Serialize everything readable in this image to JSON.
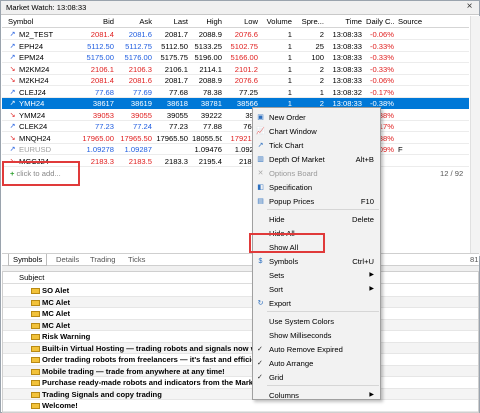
{
  "window": {
    "title": "Market Watch: 13:08:33",
    "close": "×"
  },
  "columns": [
    "Symbol",
    "Bid",
    "Ask",
    "Last",
    "High",
    "Low",
    "Volume",
    "Spre...",
    "Time",
    "Daily C...",
    "Source"
  ],
  "rows": [
    {
      "sym": "M2_TEST",
      "dir": "up",
      "bid": "2081.4",
      "ask": "2081.6",
      "last": "2081.7",
      "high": "2088.9",
      "low": "2076.6",
      "vol": "1",
      "spr": "2",
      "time": "13:08:33",
      "chg": "-0.06%",
      "src": "",
      "bidc": "dn",
      "askc": "up",
      "lowc": "dn"
    },
    {
      "sym": "EPH24",
      "dir": "up",
      "bid": "5112.50",
      "ask": "5112.75",
      "last": "5112.50",
      "high": "5133.25",
      "low": "5102.75",
      "vol": "1",
      "spr": "25",
      "time": "13:08:33",
      "chg": "-0.33%",
      "src": "",
      "bidc": "up",
      "askc": "up",
      "lowc": "dn"
    },
    {
      "sym": "EPM24",
      "dir": "up",
      "bid": "5175.00",
      "ask": "5176.00",
      "last": "5175.75",
      "high": "5196.00",
      "low": "5166.00",
      "vol": "1",
      "spr": "100",
      "time": "13:08:33",
      "chg": "-0.33%",
      "src": "",
      "bidc": "up",
      "askc": "up",
      "lowc": "dn"
    },
    {
      "sym": "M2KM24",
      "dir": "dn",
      "bid": "2106.1",
      "ask": "2106.3",
      "last": "2106.1",
      "high": "2114.1",
      "low": "2101.2",
      "vol": "1",
      "spr": "2",
      "time": "13:08:33",
      "chg": "-0.33%",
      "src": "",
      "bidc": "dn",
      "askc": "dn",
      "lowc": "dn"
    },
    {
      "sym": "M2KH24",
      "dir": "dn",
      "bid": "2081.4",
      "ask": "2081.6",
      "last": "2081.7",
      "high": "2088.9",
      "low": "2076.6",
      "vol": "1",
      "spr": "2",
      "time": "13:08:33",
      "chg": "-0.06%",
      "src": "",
      "bidc": "dn",
      "askc": "dn",
      "lowc": "dn"
    },
    {
      "sym": "CLEJ24",
      "dir": "up",
      "bid": "77.68",
      "ask": "77.69",
      "last": "77.68",
      "high": "78.38",
      "low": "77.25",
      "vol": "1",
      "spr": "1",
      "time": "13:08:32",
      "chg": "-0.17%",
      "src": "",
      "bidc": "up",
      "askc": "up",
      "lowc": ""
    },
    {
      "sym": "YMH24",
      "dir": "up",
      "bid": "38617",
      "ask": "38619",
      "last": "38618",
      "high": "38781",
      "low": "38566",
      "vol": "1",
      "spr": "2",
      "time": "13:08:33",
      "chg": "-0.38%",
      "src": "",
      "bidc": "",
      "askc": "",
      "lowc": "",
      "selected": true
    },
    {
      "sym": "YMM24",
      "dir": "dn",
      "bid": "39053",
      "ask": "39055",
      "last": "39055",
      "high": "39222",
      "low": "390",
      "vol": "",
      "spr": "",
      "time": "",
      "chg": "38%",
      "src": "",
      "bidc": "dn",
      "askc": "dn",
      "lowc": ""
    },
    {
      "sym": "CLEK24",
      "dir": "up",
      "bid": "77.23",
      "ask": "77.24",
      "last": "77.23",
      "high": "77.88",
      "low": "76.7",
      "vol": "",
      "spr": "",
      "time": "",
      "chg": "17%",
      "src": "",
      "bidc": "up",
      "askc": "up",
      "lowc": ""
    },
    {
      "sym": "MNQH24",
      "dir": "dn",
      "bid": "17965.00",
      "ask": "17965.50",
      "last": "17965.50",
      "high": "18055.50",
      "low": "17921.0",
      "vol": "",
      "spr": "",
      "time": "",
      "chg": "38%",
      "src": "",
      "bidc": "dn",
      "askc": "dn",
      "lowc": "dn"
    },
    {
      "sym": "EURUSD",
      "dir": "up",
      "bid": "1.09278",
      "ask": "1.09287",
      "last": "",
      "high": "1.09476",
      "low": "1.0927",
      "vol": "",
      "spr": "",
      "time": "",
      "chg": "09%",
      "src": "F",
      "bidc": "up",
      "askc": "up",
      "lowc": "",
      "dim": true
    },
    {
      "sym": "MGCJ24",
      "dir": "dn",
      "bid": "2183.3",
      "ask": "2183.5",
      "last": "2183.3",
      "high": "2195.4",
      "low": "2182.",
      "vol": "",
      "spr": "",
      "time": "",
      "chg": "",
      "src": "",
      "bidc": "dn",
      "askc": "dn",
      "lowc": ""
    }
  ],
  "add_placeholder": "click to add...",
  "counter": "12 / 92",
  "tabs": [
    "Symbols",
    "Details",
    "Trading",
    "Ticks"
  ],
  "news": {
    "header": "Subject",
    "items": [
      "SO Alet",
      "MC Alet",
      "MC Alet",
      "MC Alet",
      "Risk Warning",
      "Built-in Virtual Hosting — trading robots and signals now wo",
      "Order trading robots from freelancers — it's fast and efficien",
      "Mobile trading — trade from anywhere at any time!",
      "Purchase ready-made robots and indicators from the Market",
      "Trading Signals and copy trading",
      "Welcome!"
    ]
  },
  "menu": {
    "items": [
      {
        "label": "New Order",
        "shortcut": "",
        "icon": "new-order-icon"
      },
      {
        "label": "Chart Window",
        "shortcut": "",
        "icon": "chart-window-icon"
      },
      {
        "label": "Tick Chart",
        "shortcut": "",
        "icon": "tick-chart-icon"
      },
      {
        "label": "Depth Of Market",
        "shortcut": "Alt+B",
        "icon": "depth-of-market-icon"
      },
      {
        "label": "Options Board",
        "shortcut": "",
        "icon": "options-board-icon",
        "disabled": true
      },
      {
        "label": "Specification",
        "shortcut": "",
        "icon": "specification-icon"
      },
      {
        "label": "Popup Prices",
        "shortcut": "F10",
        "icon": "popup-prices-icon"
      },
      {
        "label": "Hide",
        "shortcut": "Delete"
      },
      {
        "label": "Hide All",
        "shortcut": ""
      },
      {
        "label": "Show All",
        "shortcut": ""
      },
      {
        "label": "Symbols",
        "shortcut": "Ctrl+U",
        "icon": "symbols-icon"
      },
      {
        "label": "Sets",
        "shortcut": "",
        "submenu": true
      },
      {
        "label": "Sort",
        "shortcut": "",
        "submenu": true
      },
      {
        "label": "Export",
        "shortcut": "",
        "icon": "export-icon"
      },
      {
        "label": "Use System Colors",
        "shortcut": ""
      },
      {
        "label": "Show Milliseconds",
        "shortcut": ""
      },
      {
        "label": "Auto Remove Expired",
        "shortcut": "",
        "checked": true
      },
      {
        "label": "Auto Arrange",
        "shortcut": "",
        "checked": true
      },
      {
        "label": "Grid",
        "shortcut": "",
        "checked": true
      },
      {
        "label": "Columns",
        "shortcut": "",
        "submenu": true
      }
    ],
    "check_glyph": "✓",
    "submenu_glyph": "▶"
  },
  "colors": {
    "selected_row": "#0078d7",
    "up": "#1f5de0",
    "down": "#e02020",
    "highlight_box": "#e03a3a"
  },
  "side_tag": "81"
}
